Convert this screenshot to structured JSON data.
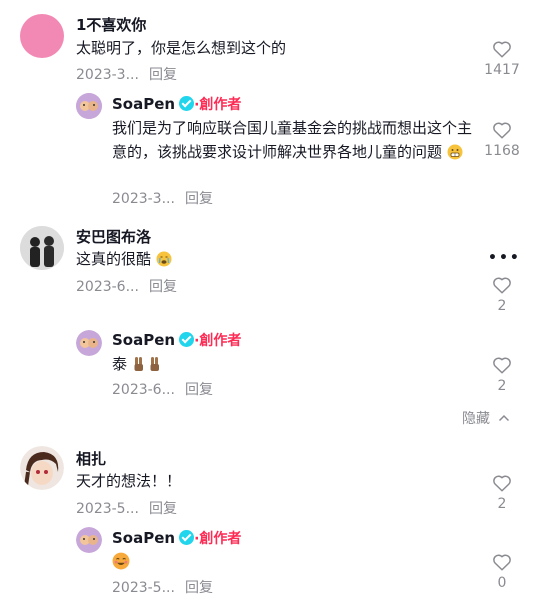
{
  "comments": [
    {
      "username": "1不喜欢你",
      "text": "太聪明了，你是怎么想到这个的",
      "date": "2023-3...",
      "reply_label": "回复",
      "likes": "1417",
      "replies": [
        {
          "username": "SoaPen",
          "creator_label": "·創作者",
          "text": "我们是为了响应联合国儿童基金会的挑战而想出这个主意的，该挑战要求设计师解决世界各地儿童的问题",
          "date": "2023-3...",
          "reply_label": "回复",
          "likes": "1168"
        }
      ]
    },
    {
      "username": "安巴图布洛",
      "text": "这真的很酷",
      "date": "2023-6...",
      "reply_label": "回复",
      "likes": "2",
      "replies": [
        {
          "username": "SoaPen",
          "creator_label": "·創作者",
          "text": "泰",
          "date": "2023-6...",
          "reply_label": "回复",
          "likes": "2"
        }
      ],
      "hide_label": "隐藏"
    },
    {
      "username": "相扎",
      "text": "天才的想法！！",
      "date": "2023-5...",
      "reply_label": "回复",
      "likes": "2",
      "replies": [
        {
          "username": "SoaPen",
          "creator_label": "·創作者",
          "text": "",
          "date": "2023-5...",
          "reply_label": "回复",
          "likes": "0"
        }
      ]
    }
  ],
  "icons": {
    "like": "heart-outline-icon",
    "more": "more-dots-icon",
    "verified": "verified-badge-icon",
    "collapse": "chevron-up-icon"
  },
  "colors": {
    "creator": "#fe2c55",
    "verified": "#20d5ec",
    "meta": "#8a8b91"
  }
}
